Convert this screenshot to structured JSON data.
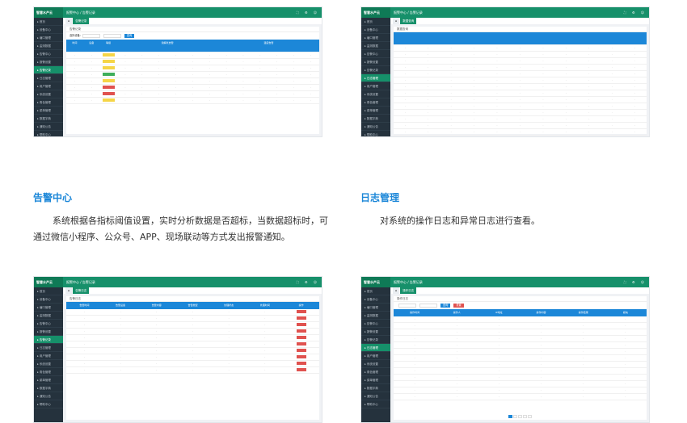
{
  "colors": {
    "accent": "#16906a",
    "brand_blue": "#1c87d8",
    "heading": "#1c87d8",
    "sidebar": "#25323d",
    "alert_yellow": "#f5d547",
    "alert_green": "#3fae5a",
    "alert_red": "#e0524f"
  },
  "sections": {
    "alarm": {
      "title": "告警中心",
      "desc": "系统根据各指标阈值设置，实时分析数据是否超标，当数据超标时，可通过微信小程序、公众号、APP、现场联动等方式发出报警通知。"
    },
    "log": {
      "title": "日志管理",
      "desc": "对系统的操作日志和异常日志进行查看。"
    }
  },
  "app": {
    "brand": "智慧水产云",
    "breadcrumb": "报警中心 / 告警记录"
  },
  "s1": {
    "tab": "告警记录",
    "panel_title": "告警记录",
    "filter_label": "选择设备:",
    "query": "查询",
    "group1": "溶解氧告警",
    "group2": "温度告警"
  },
  "s2": {
    "tab": "数据查询",
    "panel_title": "数据查询"
  },
  "s3": {
    "tab": "告警日志",
    "panel_title": "告警日志",
    "cols": [
      "告警时间",
      "告警设备",
      "告警内容",
      "告警类型",
      "处理状态",
      "处理时间",
      "操作"
    ]
  },
  "s4": {
    "tab": "操作日志",
    "panel_title": "操作日志",
    "cols": [
      "操作时间",
      "操作人",
      "IP地址",
      "操作内容",
      "操作结果",
      "模块"
    ],
    "btn_query": "查询",
    "btn_reset": "重置"
  },
  "sidebar": [
    "首页",
    "设备中心",
    "塘口管理",
    "监测数据",
    "告警中心",
    "报警设置",
    "告警记录",
    "日志管理",
    "用户管理",
    "系统设置",
    "角色管理",
    "菜单管理",
    "数据字典",
    "通知公告",
    "帮助中心"
  ]
}
